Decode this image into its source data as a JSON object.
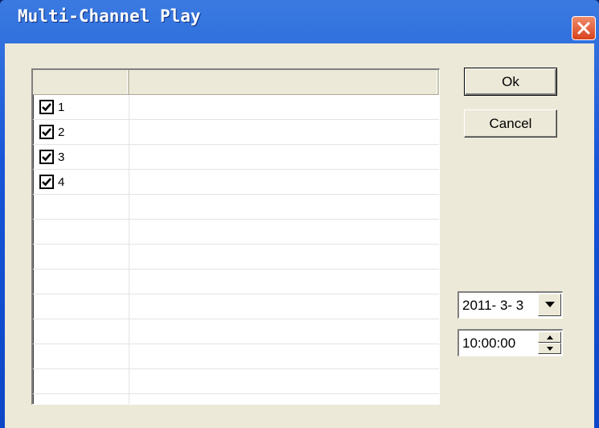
{
  "window": {
    "title": "Multi-Channel Play"
  },
  "channels": {
    "header_col1": "",
    "header_col2": "",
    "items": [
      {
        "label": "1",
        "checked": true
      },
      {
        "label": "2",
        "checked": true
      },
      {
        "label": "3",
        "checked": true
      },
      {
        "label": "4",
        "checked": true
      }
    ]
  },
  "buttons": {
    "ok_label": "Ok",
    "cancel_label": "Cancel"
  },
  "date_picker": {
    "value": "2011- 3- 3"
  },
  "time_picker": {
    "value": "10:00:00"
  }
}
